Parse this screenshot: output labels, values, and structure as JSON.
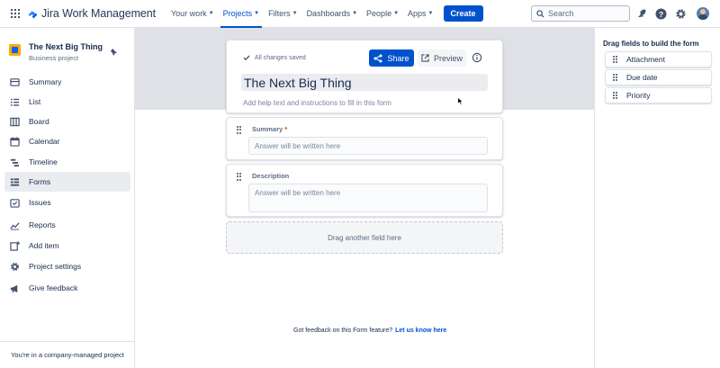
{
  "topnav": {
    "logo_text": "Jira Work Management",
    "items": [
      {
        "label": "Your work"
      },
      {
        "label": "Projects"
      },
      {
        "label": "Filters"
      },
      {
        "label": "Dashboards"
      },
      {
        "label": "People"
      },
      {
        "label": "Apps"
      }
    ],
    "active_item": "Projects",
    "create_label": "Create",
    "search_placeholder": "Search",
    "accent_color": "#0052cc"
  },
  "sidebar": {
    "project_name": "The Next Big Thing",
    "project_type": "Business project",
    "items": [
      {
        "label": "Summary",
        "icon": "summary-icon"
      },
      {
        "label": "List",
        "icon": "list-icon"
      },
      {
        "label": "Board",
        "icon": "board-icon"
      },
      {
        "label": "Calendar",
        "icon": "calendar-icon"
      },
      {
        "label": "Timeline",
        "icon": "timeline-icon"
      },
      {
        "label": "Forms",
        "icon": "forms-icon",
        "active": true
      },
      {
        "label": "Issues",
        "icon": "issues-icon"
      },
      {
        "label": "Reports",
        "icon": "reports-icon"
      },
      {
        "label": "Add item",
        "icon": "add-item-icon"
      },
      {
        "label": "Project settings",
        "icon": "gear-icon"
      },
      {
        "label": "Give feedback",
        "icon": "megaphone-icon"
      }
    ],
    "footer": "You're in a company-managed project"
  },
  "form": {
    "saved_status": "All changes saved",
    "share_label": "Share",
    "preview_label": "Preview",
    "title": "The Next Big Thing",
    "help_placeholder": "Add help text and instructions to fill in this form",
    "fields": [
      {
        "label": "Summary",
        "required": "*",
        "placeholder": "Answer will be written here"
      },
      {
        "label": "Description",
        "placeholder": "Answer will be written here"
      }
    ],
    "dropzone": "Drag another field here",
    "feedback_text": "Got feedback on this Form feature?",
    "feedback_link": "Let us know here"
  },
  "right_panel": {
    "title": "Drag fields to build the form",
    "fields": [
      {
        "label": "Attachment"
      },
      {
        "label": "Due date"
      },
      {
        "label": "Priority"
      }
    ]
  }
}
